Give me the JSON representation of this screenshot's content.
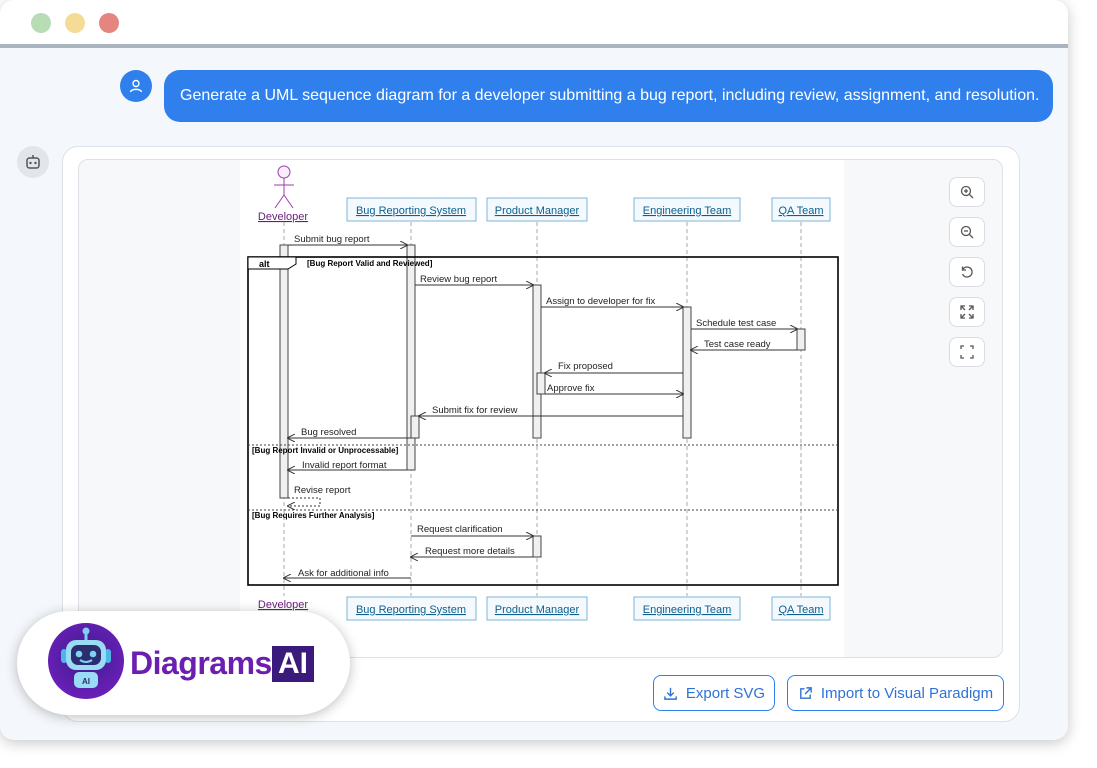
{
  "window": {
    "traffic_lights": [
      "close",
      "minimize",
      "maximize"
    ]
  },
  "chat": {
    "user_icon": "user-icon",
    "user_message": "Generate a UML sequence diagram for a developer submitting a bug report, including review, assignment, and resolution.",
    "bot_icon": "robot-icon"
  },
  "diagram": {
    "participants": {
      "developer": "Developer",
      "brs": "Bug Reporting System",
      "pm": "Product Manager",
      "eng": "Engineering Team",
      "qa": "QA Team"
    },
    "alt_label": "alt",
    "guards": {
      "g1": "[Bug Report Valid and Reviewed]",
      "g2": "[Bug Report Invalid or Unprocessable]",
      "g3": "[Bug Requires Further Analysis]"
    },
    "messages": {
      "m1": "Submit bug report",
      "m2": "Review bug report",
      "m3": "Assign to developer for fix",
      "m4": "Schedule test case",
      "m5": "Test case ready",
      "m6": "Fix proposed",
      "m7": "Approve fix",
      "m8": "Submit fix for review",
      "m9": "Bug resolved",
      "m10": "Invalid report format",
      "m11": "Revise report",
      "m12": "Request clarification",
      "m13": "Request more details",
      "m14": "Ask for additional info"
    }
  },
  "zoom_controls": [
    "zoom-in-icon",
    "zoom-out-icon",
    "reset-icon",
    "fit-icon",
    "fullscreen-icon"
  ],
  "actions": {
    "export_label": "Export SVG",
    "import_label": "Import to Visual Paradigm"
  },
  "brand": {
    "name": "Diagrams",
    "suffix": "AI",
    "robot_text": "AI"
  },
  "colors": {
    "accent": "#2f80ed",
    "brand_purple": "#6b1fb0",
    "participant_fill": "#f3f9fd",
    "participant_border": "#7fb4d6",
    "participant_text": "#0d5f8f",
    "actor_color": "#a03ab0"
  }
}
